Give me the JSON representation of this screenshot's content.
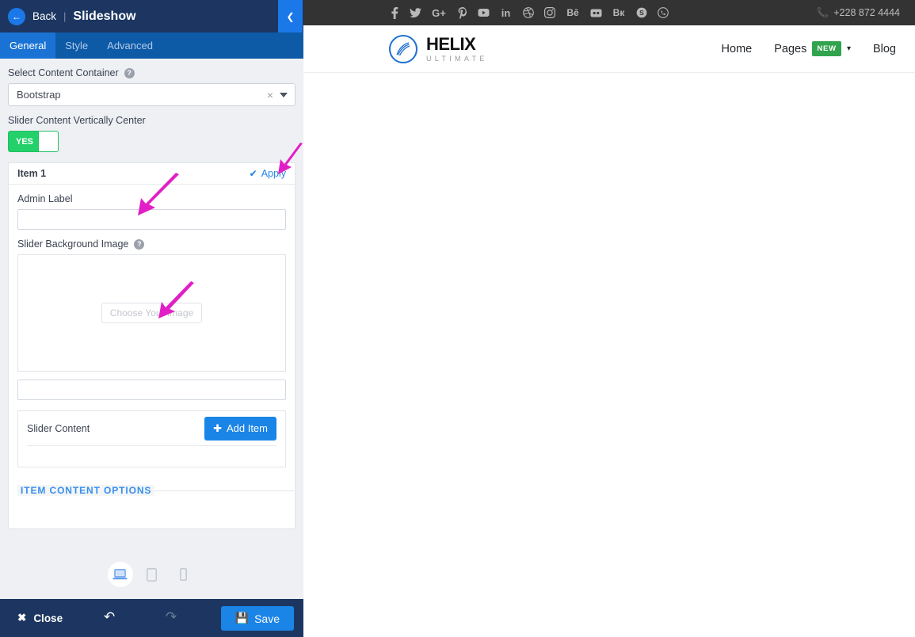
{
  "sidebar": {
    "header": {
      "back_label": "Back",
      "separator": "|",
      "title": "Slideshow",
      "back_icon": "arrow-left-icon",
      "collapse_icon": "chevron-left-icon"
    },
    "tabs": [
      {
        "label": "General",
        "active": true
      },
      {
        "label": "Style",
        "active": false
      },
      {
        "label": "Advanced",
        "active": false
      }
    ],
    "fields": {
      "container_label": "Select Content Container",
      "container_value": "Bootstrap",
      "container_clear": "×",
      "vertical_center_label": "Slider Content Vertically Center",
      "vertical_center_state": "YES"
    },
    "item": {
      "title": "Item 1",
      "apply_label": "Apply",
      "apply_check": "✔",
      "admin_label": "Admin Label",
      "admin_value": "",
      "admin_placeholder": "",
      "bg_image_label": "Slider Background Image",
      "choose_image_label": "Choose Your Image",
      "alt_value": "",
      "alt_placeholder": "",
      "slider_content_label": "Slider Content",
      "add_item_label": "Add Item",
      "add_item_icon": "plus-icon"
    },
    "legend": "ITEM CONTENT OPTIONS",
    "devices": [
      {
        "name": "desktop",
        "icon": "laptop-icon",
        "active": true
      },
      {
        "name": "tablet",
        "icon": "tablet-icon",
        "active": false
      },
      {
        "name": "mobile",
        "icon": "mobile-icon",
        "active": false
      }
    ],
    "footer": {
      "close_label": "Close",
      "close_icon": "x-icon",
      "undo_icon": "undo-arrow-icon",
      "redo_icon": "redo-arrow-icon",
      "save_label": "Save",
      "save_icon": "floppy-disk-icon"
    }
  },
  "preview": {
    "social": [
      "facebook-icon",
      "twitter-icon",
      "google-plus-icon",
      "pinterest-icon",
      "youtube-icon",
      "linkedin-icon",
      "dribbble-icon",
      "instagram-icon",
      "behance-icon",
      "flickr-icon",
      "vk-icon",
      "skype-icon",
      "whatsapp-icon"
    ],
    "phone": "+228 872 4444",
    "phone_icon": "phone-icon",
    "logo": {
      "name": "HELIX",
      "sub": "ULTIMATE",
      "mark": "helix-swoosh-icon"
    },
    "nav": [
      {
        "label": "Home",
        "badge": "",
        "caret": false
      },
      {
        "label": "Pages",
        "badge": "NEW",
        "caret": true
      },
      {
        "label": "Blog",
        "badge": "",
        "caret": false
      }
    ],
    "nav_caret_glyph": "⌄"
  },
  "colors": {
    "header_navy": "#1c3661",
    "tabbar_blue": "#0d5aa7",
    "active_tab_blue": "#1a73d4",
    "primary_blue": "#1b84e7",
    "toggle_green": "#24d06a",
    "legend_blue": "#3690ed",
    "annotation_magenta": "#e21fc6",
    "badge_green": "#31a34d"
  },
  "annotations": [
    {
      "name": "arrow-to-admin-label",
      "target": "admin-label-field"
    },
    {
      "name": "arrow-to-apply",
      "target": "apply-link"
    },
    {
      "name": "arrow-to-choose-image",
      "target": "choose-image-button"
    }
  ]
}
